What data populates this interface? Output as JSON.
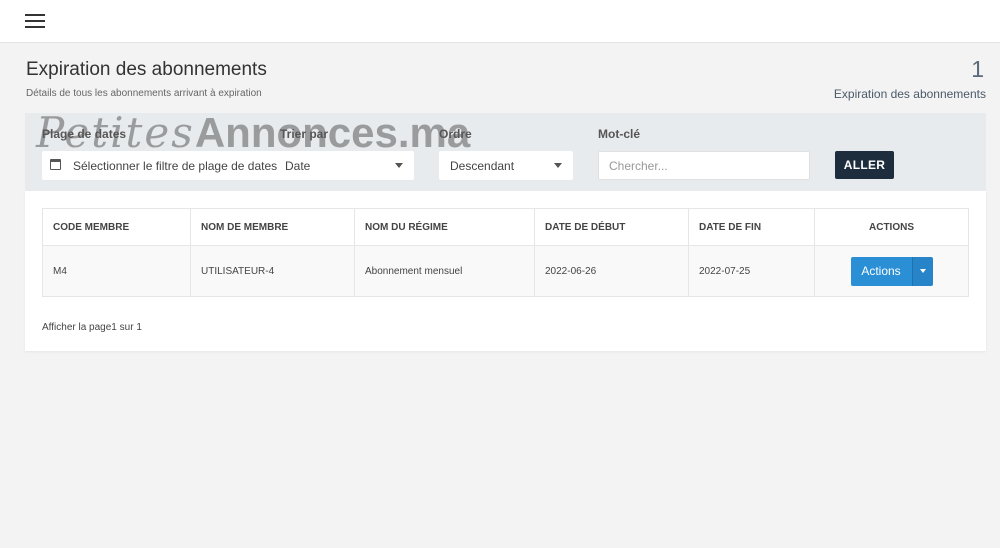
{
  "header": {
    "menu_icon": "hamburger-menu-icon"
  },
  "page": {
    "title": "Expiration des abonnements",
    "subtitle": "Détails de tous les abonnements arrivant à expiration",
    "count": "1",
    "count_label": "Expiration des abonnements"
  },
  "filters": {
    "date_range_label": "Plage de dates",
    "date_range_placeholder": "Sélectionner le filtre de plage de dates",
    "date_range_icon": "calendar-icon",
    "sort_label": "Trier par",
    "sort_value": "Date",
    "order_label": "Ordre",
    "order_value": "Descendant",
    "keyword_label": "Mot-clé",
    "keyword_placeholder": "Chercher...",
    "go_label": "ALLER"
  },
  "table": {
    "columns": [
      "CODE MEMBRE",
      "NOM DE MEMBRE",
      "NOM DU RÉGIME",
      "DATE DE DÉBUT",
      "DATE DE FIN",
      "ACTIONS"
    ],
    "rows": [
      {
        "code": "M4",
        "name": "UTILISATEUR-4",
        "plan": "Abonnement mensuel",
        "start": "2022-06-26",
        "end": "2022-07-25",
        "action_label": "Actions"
      }
    ]
  },
  "pagination": {
    "text": "Afficher la page1 sur 1"
  },
  "watermark": {
    "part1": "Petites",
    "part2": "Annonces.ma"
  },
  "colors": {
    "primary_button": "#2b8fd6",
    "go_button": "#1e2d3d",
    "filter_panel": "#e8ebee"
  }
}
